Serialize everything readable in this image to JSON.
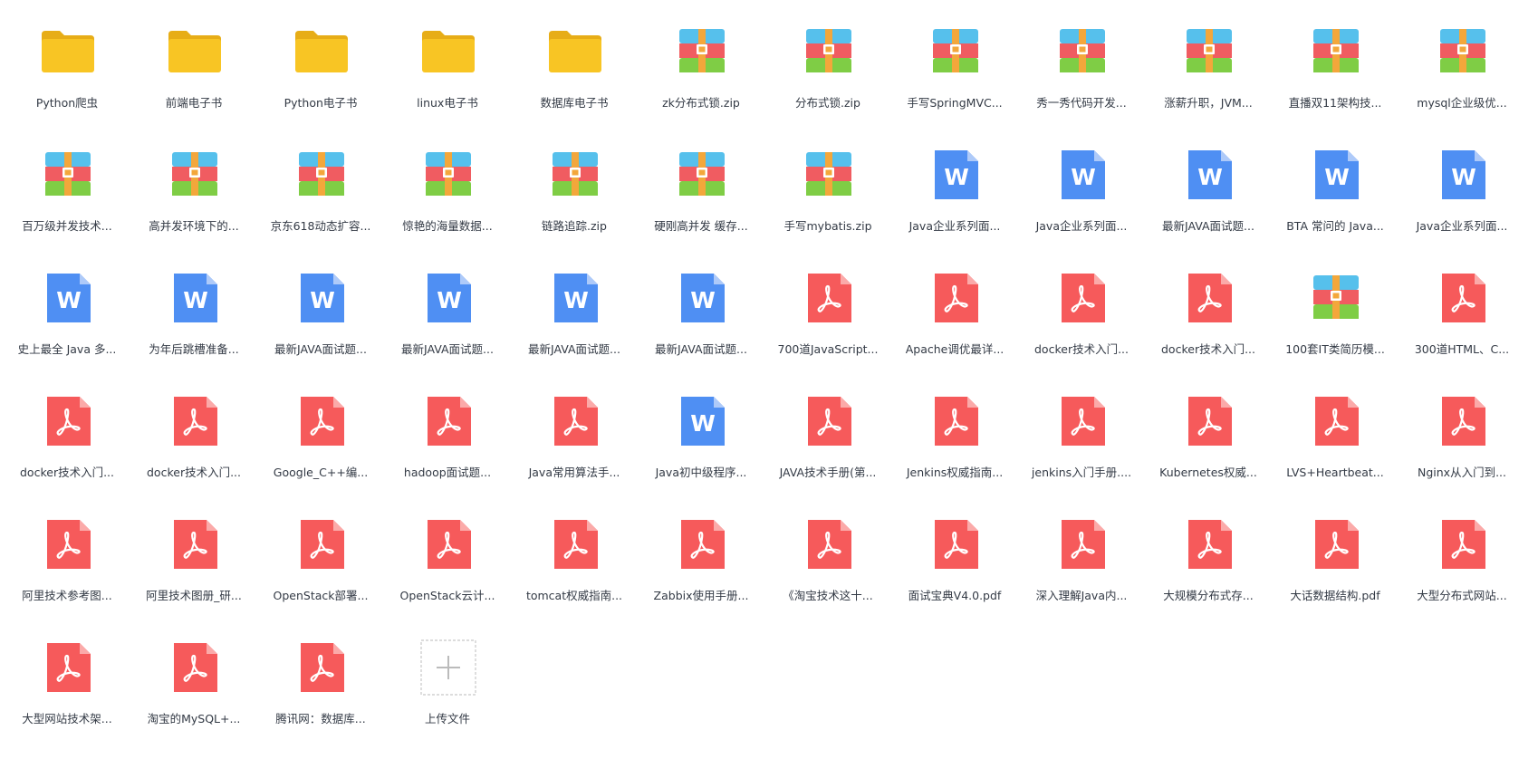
{
  "theme": {
    "folder": "#f8c524",
    "folder_tab": "#e7ad17",
    "archive_blue": "#56c0ec",
    "archive_red": "#f05c61",
    "archive_green": "#7fcd45",
    "archive_band": "#f3a73b",
    "word": "#4f8ff3",
    "pdf": "#f65a5b",
    "upload_border": "#c8c8c8",
    "label": "#333a45"
  },
  "files": [
    {
      "name": "Python爬虫",
      "icon": "folder-icon"
    },
    {
      "name": "前端电子书",
      "icon": "folder-icon"
    },
    {
      "name": "Python电子书",
      "icon": "folder-icon"
    },
    {
      "name": "linux电子书",
      "icon": "folder-icon"
    },
    {
      "name": "数据库电子书",
      "icon": "folder-icon"
    },
    {
      "name": "zk分布式锁.zip",
      "icon": "archive-icon"
    },
    {
      "name": "分布式锁.zip",
      "icon": "archive-icon"
    },
    {
      "name": "手写SpringMVC...",
      "icon": "archive-icon"
    },
    {
      "name": "秀一秀代码开发...",
      "icon": "archive-icon"
    },
    {
      "name": "涨薪升职，JVM...",
      "icon": "archive-icon"
    },
    {
      "name": "直播双11架构技...",
      "icon": "archive-icon"
    },
    {
      "name": "mysql企业级优...",
      "icon": "archive-icon"
    },
    {
      "name": "百万级并发技术...",
      "icon": "archive-icon"
    },
    {
      "name": "高并发环境下的...",
      "icon": "archive-icon"
    },
    {
      "name": "京东618动态扩容...",
      "icon": "archive-icon"
    },
    {
      "name": "惊艳的海量数据...",
      "icon": "archive-icon"
    },
    {
      "name": "链路追踪.zip",
      "icon": "archive-icon"
    },
    {
      "name": "硬刚高并发 缓存...",
      "icon": "archive-icon"
    },
    {
      "name": "手写mybatis.zip",
      "icon": "archive-icon"
    },
    {
      "name": "Java企业系列面...",
      "icon": "word-doc-icon"
    },
    {
      "name": "Java企业系列面...",
      "icon": "word-doc-icon"
    },
    {
      "name": "最新JAVA面试题...",
      "icon": "word-doc-icon"
    },
    {
      "name": "BTA 常问的 Java...",
      "icon": "word-doc-icon"
    },
    {
      "name": "Java企业系列面...",
      "icon": "word-doc-icon"
    },
    {
      "name": "史上最全 Java 多...",
      "icon": "word-doc-icon"
    },
    {
      "name": "为年后跳槽准备...",
      "icon": "word-doc-icon"
    },
    {
      "name": "最新JAVA面试题...",
      "icon": "word-doc-icon"
    },
    {
      "name": "最新JAVA面试题...",
      "icon": "word-doc-icon"
    },
    {
      "name": "最新JAVA面试题...",
      "icon": "word-doc-icon"
    },
    {
      "name": "最新JAVA面试题...",
      "icon": "word-doc-icon"
    },
    {
      "name": "700道JavaScript...",
      "icon": "pdf-icon"
    },
    {
      "name": "Apache调优最详...",
      "icon": "pdf-icon"
    },
    {
      "name": "docker技术入门...",
      "icon": "pdf-icon"
    },
    {
      "name": "docker技术入门...",
      "icon": "pdf-icon"
    },
    {
      "name": "100套IT类简历模...",
      "icon": "archive-icon"
    },
    {
      "name": "300道HTML、C...",
      "icon": "pdf-icon"
    },
    {
      "name": "docker技术入门...",
      "icon": "pdf-icon"
    },
    {
      "name": "docker技术入门...",
      "icon": "pdf-icon"
    },
    {
      "name": "Google_C++编...",
      "icon": "pdf-icon"
    },
    {
      "name": "hadoop面试题...",
      "icon": "pdf-icon"
    },
    {
      "name": "Java常用算法手...",
      "icon": "pdf-icon"
    },
    {
      "name": "Java初中级程序...",
      "icon": "word-doc-icon"
    },
    {
      "name": "JAVA技术手册(第...",
      "icon": "pdf-icon"
    },
    {
      "name": "Jenkins权威指南...",
      "icon": "pdf-icon"
    },
    {
      "name": "jenkins入门手册....",
      "icon": "pdf-icon"
    },
    {
      "name": "Kubernetes权威...",
      "icon": "pdf-icon"
    },
    {
      "name": "LVS+Heartbeat...",
      "icon": "pdf-icon"
    },
    {
      "name": "Nginx从入门到...",
      "icon": "pdf-icon"
    },
    {
      "name": "阿里技术参考图...",
      "icon": "pdf-icon"
    },
    {
      "name": "阿里技术图册_研...",
      "icon": "pdf-icon"
    },
    {
      "name": "OpenStack部署...",
      "icon": "pdf-icon"
    },
    {
      "name": "OpenStack云计...",
      "icon": "pdf-icon"
    },
    {
      "name": "tomcat权威指南...",
      "icon": "pdf-icon"
    },
    {
      "name": "Zabbix使用手册...",
      "icon": "pdf-icon"
    },
    {
      "name": "《淘宝技术这十...",
      "icon": "pdf-icon"
    },
    {
      "name": "面试宝典V4.0.pdf",
      "icon": "pdf-icon"
    },
    {
      "name": "深入理解Java内...",
      "icon": "pdf-icon"
    },
    {
      "name": "大规模分布式存...",
      "icon": "pdf-icon"
    },
    {
      "name": "大话数据结构.pdf",
      "icon": "pdf-icon"
    },
    {
      "name": "大型分布式网站...",
      "icon": "pdf-icon"
    },
    {
      "name": "大型网站技术架...",
      "icon": "pdf-icon"
    },
    {
      "name": "淘宝的MySQL+...",
      "icon": "pdf-icon"
    },
    {
      "name": "腾讯网：数据库...",
      "icon": "pdf-icon"
    }
  ],
  "upload": {
    "label": "上传文件",
    "icon": "plus-icon"
  }
}
